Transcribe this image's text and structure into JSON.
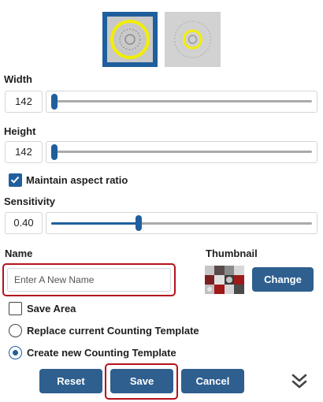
{
  "templates": [
    {
      "name": "template-selected"
    },
    {
      "name": "template-alt"
    }
  ],
  "width": {
    "label": "Width",
    "value": "142",
    "slider_fraction": 0.0
  },
  "height": {
    "label": "Height",
    "value": "142",
    "slider_fraction": 0.0
  },
  "aspect": {
    "label": "Maintain aspect ratio",
    "checked": true
  },
  "sensitivity": {
    "label": "Sensitivity",
    "value": "0.40",
    "slider_fraction": 0.4
  },
  "name": {
    "label": "Name",
    "placeholder": "Enter A New Name"
  },
  "thumbnail": {
    "label": "Thumbnail",
    "change_label": "Change"
  },
  "save_area": {
    "label": "Save Area",
    "checked": false
  },
  "replace": {
    "label": "Replace current Counting Template",
    "selected": false
  },
  "create": {
    "label": "Create new Counting Template",
    "selected": true
  },
  "buttons": {
    "reset": "Reset",
    "save": "Save",
    "cancel": "Cancel"
  },
  "icons": {
    "collapse": "double-chevron-down-icon"
  },
  "colors": {
    "accent": "#1f5f9d",
    "button": "#2e5f8f",
    "highlight": "#b5121b",
    "ring": "#f2ee00"
  }
}
